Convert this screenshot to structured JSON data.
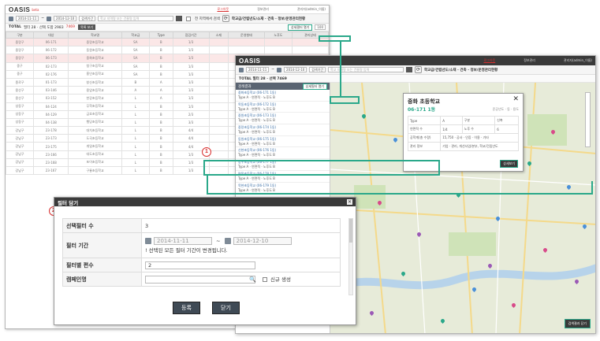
{
  "win1": {
    "logo": "OASIS",
    "logo_sub": "beta",
    "top_links": [
      "로그아웃",
      "정보관리",
      "관리자(admin_이름)"
    ],
    "date_from": "2014-11-11",
    "date_to": "2014-12-10",
    "period_label": "검색기간",
    "search_placeholder": "학교 지역명 또는 건물명 입력",
    "checkbox_label": "전 지역에서 검색",
    "layer_label": "학교급/건립년도/소재 · 건축 · 정보/운영관리현황",
    "total_label": "TOTAL",
    "total_text": "필터 28 · 선택 도합 2983",
    "total_count": "7469",
    "action_btn": "목록 보기",
    "detail_btn": "상세필터 열기",
    "page_size": "100",
    "rows": [
      [
        "구분",
        "대상",
        "학교명",
        "학교급",
        "Type",
        "점검기간",
        "소재",
        "운영형태",
        "노후도",
        "관리상태"
      ],
      [
        "중랑구",
        "06-171",
        "중랑초등학교",
        "SA",
        "B",
        "1/3"
      ],
      [
        "중랑구",
        "06-172",
        "동원초등학교",
        "SA",
        "B",
        "1/3"
      ],
      [
        "중랑구",
        "06-173",
        "중화초등학교",
        "SA",
        "B",
        "1/3"
      ],
      [
        "중구",
        "02-173",
        "청구초등학교",
        "SA",
        "B",
        "1/3"
      ],
      [
        "중구",
        "02-176",
        "흥인초등학교",
        "SA",
        "B",
        "1/3"
      ],
      [
        "종로구",
        "01-173",
        "창신초등학교",
        "B",
        "A",
        "1/3"
      ],
      [
        "용산구",
        "03-146",
        "용암초등학교",
        "A",
        "A",
        "1/3"
      ],
      [
        "용산구",
        "03-152",
        "한강초등학교",
        "L",
        "A",
        "1/3"
      ],
      [
        "성동구",
        "04-124",
        "무학초등학교",
        "L",
        "B",
        "1/3"
      ],
      [
        "성동구",
        "04-129",
        "금호초등학교",
        "L",
        "B",
        "2/3"
      ],
      [
        "성동구",
        "04-138",
        "행당초등학교",
        "L",
        "B",
        "3/3"
      ],
      [
        "강남구",
        "23-178",
        "대치초등학교",
        "L",
        "B",
        "4/4"
      ],
      [
        "강남구",
        "23-173",
        "도곡초등학교",
        "L",
        "B",
        "4/4"
      ],
      [
        "강남구",
        "23-175",
        "개일초등학교",
        "L",
        "B",
        "4/4"
      ],
      [
        "강남구",
        "23-166",
        "대도초등학교",
        "L",
        "B",
        "1/3"
      ],
      [
        "강남구",
        "23-168",
        "포이초등학교",
        "L",
        "B",
        "1/3"
      ],
      [
        "강남구",
        "23-167",
        "구룡초등학교",
        "L",
        "B",
        "1/3"
      ]
    ]
  },
  "win2": {
    "logo": "OASIS",
    "top_links": [
      "로그아웃",
      "정보관리",
      "관리자(admin_이름)"
    ],
    "date_from": "2014-11-11",
    "date_to": "2014-12-10",
    "period_label": "검색기간",
    "search_placeholder": "학교 지역명 또는 건물명 입력",
    "layer_label": "학교급/건립년도/소재 · 건축 · 정보/운영관리현황",
    "total_text": "TOTAL 필터 28 · 선택 7469",
    "list_head": "검색결과",
    "list_head_btn": "상세필터 열기",
    "list_items": [
      [
        "중화초등학교 (06-171 1동)",
        "Type A · 연면적 · 노후도 B"
      ],
      [
        "목동초등학교 (06-172 1동)",
        "Type A · 연면적 · 노후도 B"
      ],
      [
        "중원초등학교 (06-173 1동)",
        "Type A · 연면적 · 노후도 B"
      ],
      [
        "중랑초등학교 (06-174 1동)",
        "Type A · 연면적 · 노후도 B"
      ],
      [
        "동원초등학교 (06-175 1동)",
        "Type A · 연면적 · 노후도 B"
      ],
      [
        "신현초등학교 (06-176 1동)",
        "Type A · 연면적 · 노후도 B"
      ],
      [
        "망우초등학교 (06-177 1동)",
        "Type A · 연면적 · 노후도 B"
      ],
      [
        "면목초등학교 (06-178 1동)",
        "Type A · 연면적 · 노후도 B"
      ],
      [
        "묵현초등학교 (06-179 1동)",
        "Type A · 연면적 · 노후도 B"
      ]
    ],
    "popup": {
      "title": "중화 초등학교",
      "subtitle": "06-171 1동",
      "tags": "준공년도 · 동 · 용도",
      "rows": [
        [
          "Type",
          "A",
          "구분",
          "신축"
        ],
        [
          "연면적 수",
          "1/4",
          "노후 수",
          "6"
        ],
        [
          "공학계(총 수량)",
          "15,750 · 공사 · 인증 · 이용 · 기타",
          "",
          ""
        ],
        [
          "관리 정보",
          "기업 · 관리, 개선사업/본부, 학교/건립년도",
          "",
          ""
        ]
      ],
      "close": "✕",
      "detail_btn": "상세보기"
    },
    "bottom_btn": "검색결과 닫기"
  },
  "callouts": {
    "badge1": "1",
    "badge2": "2"
  },
  "dialog": {
    "title": "필터 담기",
    "close": "✕",
    "rows": {
      "select_count_label": "선택필터 수",
      "select_count_value": "3",
      "period_label": "필터 기간",
      "date_from": "2014-11-11",
      "date_sep": "~",
      "date_to": "2014-12-10",
      "period_note": "! 선택된 모든 필터 기간이 변경됩니다.",
      "count_label": "필터별 편수",
      "count_value": "2",
      "campaign_label": "캠페인명",
      "campaign_value": "",
      "new_label": "신규 생성"
    },
    "submit": "등록",
    "cancel": "닫기"
  },
  "colors": {
    "accent_green": "#2aa88a",
    "accent_red": "#d83030",
    "header_dark": "#3a3a3a"
  }
}
